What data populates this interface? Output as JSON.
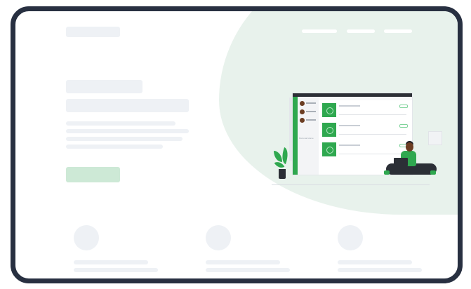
{
  "app": {
    "sidebar_label": "Personal Home"
  },
  "colors": {
    "frame_border": "#283041",
    "accent_green": "#2fa84f",
    "blob_bg": "#e8f2ec",
    "placeholder": "#eef1f5",
    "cta_fill": "#cde9d6"
  },
  "icons": {
    "hero_illustration": "person-with-laptop-illustration",
    "feature_icons": [
      "feature-placeholder-icon",
      "feature-placeholder-icon",
      "feature-placeholder-icon"
    ]
  }
}
